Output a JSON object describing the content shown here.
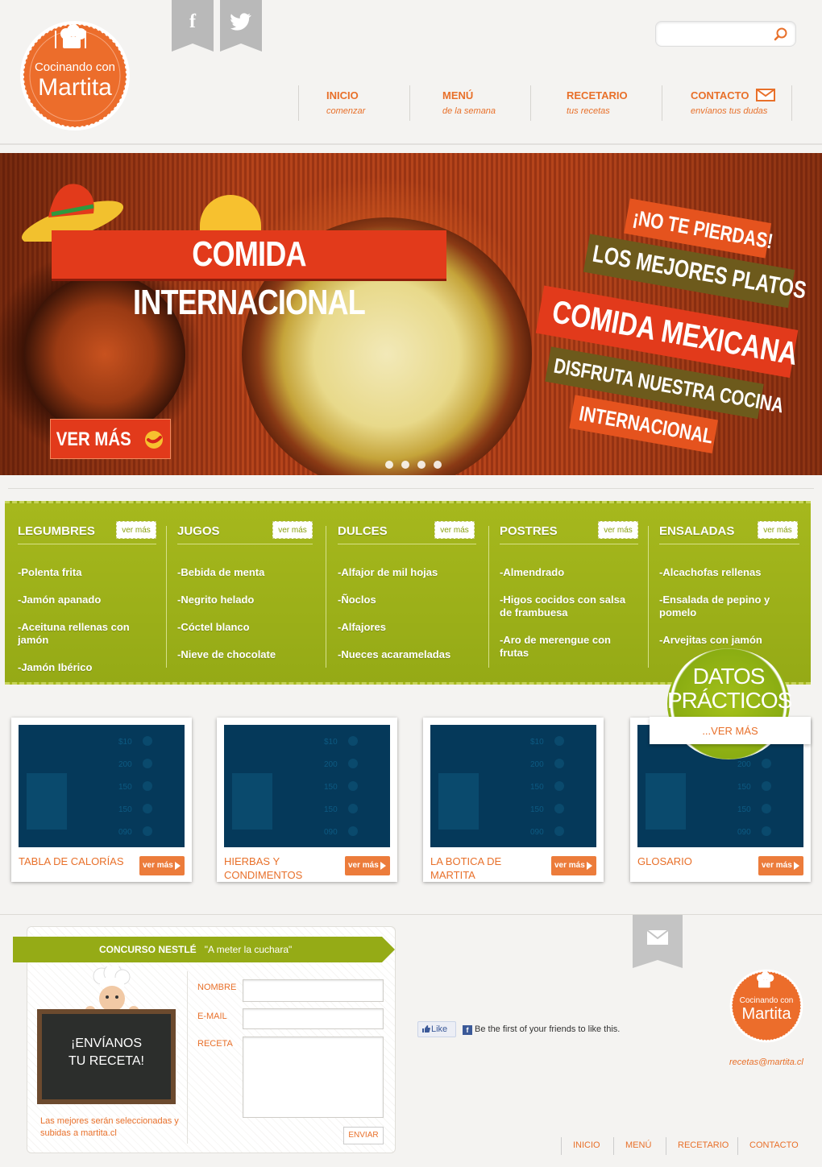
{
  "brand": {
    "line1": "Cocinando con",
    "line2": "Martita",
    "color_orange": "#e8702a",
    "color_green": "#95ab16"
  },
  "social": [
    {
      "icon": "facebook-icon",
      "glyph": "f"
    },
    {
      "icon": "twitter-icon",
      "glyph": "t"
    }
  ],
  "search": {
    "placeholder": "",
    "value": ""
  },
  "nav": [
    {
      "label": "INICIO",
      "sub": "comenzar"
    },
    {
      "label": "MENÚ",
      "sub": "de la semana"
    },
    {
      "label": "RECETARIO",
      "sub": "tus recetas"
    },
    {
      "label": "CONTACTO",
      "sub": "envíanos tus dudas"
    }
  ],
  "hero": {
    "title": "COMIDA INTERNACIONAL",
    "cta": "VER MÁS",
    "ribbons": [
      "¡NO TE PIERDAS!",
      "LOS MEJORES PLATOS",
      "COMIDA MEXICANA",
      "DISFRUTA NUESTRA COCINA",
      "INTERNACIONAL"
    ],
    "slides": 4,
    "active_slide": 1
  },
  "categories": [
    {
      "title": "LEGUMBRES",
      "more": "ver más",
      "items": [
        "-Polenta frita",
        "-Jamón apanado",
        "-Aceituna rellenas con jamón",
        "-Jamón Ibérico"
      ]
    },
    {
      "title": "JUGOS",
      "more": "ver más",
      "items": [
        "-Bebida de menta",
        "-Negrito helado",
        "-Cóctel blanco",
        "-Nieve de chocolate"
      ]
    },
    {
      "title": "DULCES",
      "more": "ver más",
      "items": [
        "-Alfajor de mil hojas",
        "-Ñoclos",
        "-Alfajores",
        "-Nueces acarameladas"
      ]
    },
    {
      "title": "POSTRES",
      "more": "ver más",
      "items": [
        "-Almendrado",
        "-Higos cocidos con salsa de frambuesa",
        "-Aro de merengue con frutas"
      ]
    },
    {
      "title": "ENSALADAS",
      "more": "ver más",
      "items": [
        "-Alcachofas rellenas",
        "-Ensalada de pepino y pomelo",
        "-Arvejitas con jamón"
      ]
    }
  ],
  "datos": {
    "line1": "DATOS",
    "line2": "PRÁCTICOS",
    "more": "...VER MÁS"
  },
  "cards": [
    {
      "title": "TABLA DE CALORÍAS",
      "more": "ver más"
    },
    {
      "title": "HIERBAS Y CONDIMENTOS",
      "more": "ver más"
    },
    {
      "title": "LA BOTICA DE MARTITA",
      "more": "ver más"
    },
    {
      "title": "GLOSARIO",
      "more": "ver más"
    }
  ],
  "card_image_values": [
    "$10",
    "200",
    "150",
    "150",
    "090"
  ],
  "contest": {
    "label": "CONCURSO NESTLÉ",
    "quote": "\"A meter la cuchara\"",
    "board_line1": "¡ENVÍANOS",
    "board_line2": "TU RECETA!",
    "note": "Las mejores serán seleccionadas y subidas a martita.cl",
    "name_label": "NOMBRE",
    "email_label": "E-MAIL",
    "recipe_label": "RECETA",
    "send": "ENVIAR"
  },
  "facebook": {
    "like": "Like",
    "text": "Be the first of your friends to like this."
  },
  "footer": {
    "email": "recetas@martita.cl",
    "nav": [
      "INICIO",
      "MENÚ",
      "RECETARIO",
      "CONTACTO"
    ]
  }
}
